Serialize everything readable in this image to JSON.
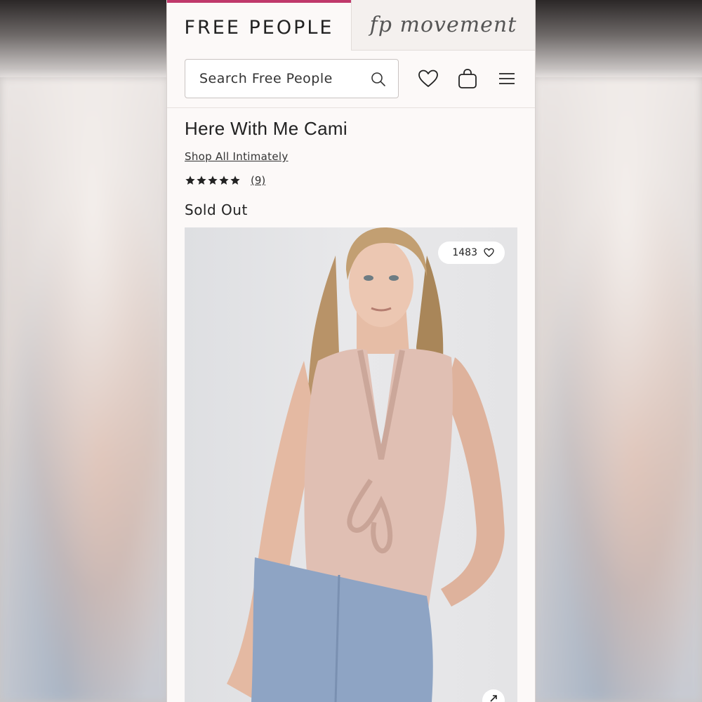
{
  "brand_tabs": {
    "primary": "FREE PEOPLE",
    "secondary": "fp movement"
  },
  "header": {
    "search_placeholder": "Search Free People",
    "icons": [
      "search-icon",
      "heart-icon",
      "bag-icon",
      "menu-icon"
    ]
  },
  "product": {
    "title": "Here With Me Cami",
    "shop_link": "Shop All Intimately",
    "rating_stars": 5,
    "review_count": "(9)",
    "status": "Sold Out",
    "favorites_count": "1483"
  },
  "colors": {
    "accent": "#c0396b",
    "background": "#fcf9f8",
    "text": "#222222"
  }
}
